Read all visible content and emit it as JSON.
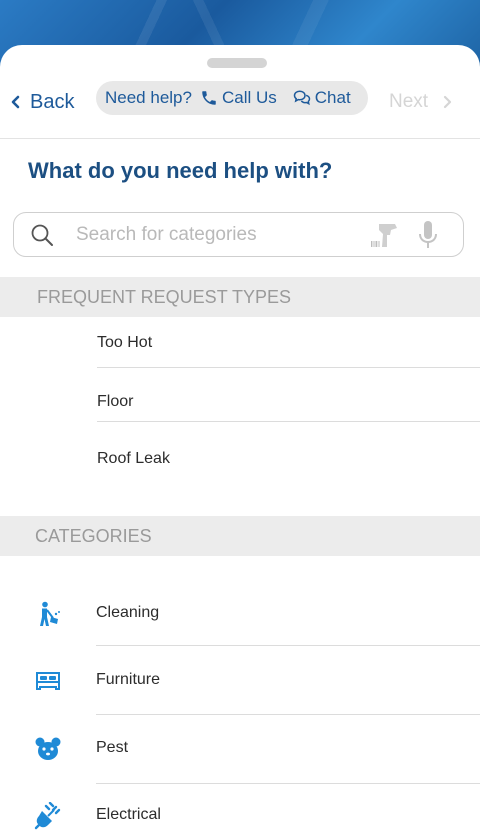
{
  "nav": {
    "back_label": "Back",
    "help_label": "Need help?",
    "call_label": "Call Us",
    "chat_label": "Chat",
    "next_label": "Next"
  },
  "question": "What do you need help with?",
  "search": {
    "placeholder": "Search for categories",
    "value": ""
  },
  "frequent": {
    "header": "FREQUENT REQUEST TYPES",
    "items": [
      "Too Hot",
      "Floor",
      "Roof Leak"
    ]
  },
  "categories": {
    "header": "CATEGORIES",
    "items": [
      {
        "label": "Cleaning",
        "icon": "cleaning-icon"
      },
      {
        "label": "Furniture",
        "icon": "bed-icon"
      },
      {
        "label": "Pest",
        "icon": "pest-icon"
      },
      {
        "label": "Electrical",
        "icon": "plug-icon"
      }
    ]
  },
  "colors": {
    "accent": "#1e5a9a",
    "heading": "#1c4f82",
    "icon": "#1f8ad6",
    "section_bg": "#ececec"
  }
}
